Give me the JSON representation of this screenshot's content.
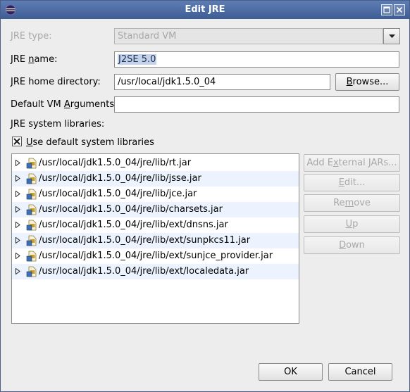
{
  "window": {
    "title": "Edit JRE"
  },
  "form": {
    "jre_type_label": "JRE type:",
    "jre_type_value": "Standard VM",
    "jre_name_label_pre": "JRE ",
    "jre_name_label_u": "n",
    "jre_name_label_post": "ame:",
    "jre_name_value": "J2SE 5.0",
    "home_label_u": "J",
    "home_label_post": "RE home directory:",
    "home_value": "/usr/local/jdk1.5.0_04",
    "browse_u": "B",
    "browse_post": "rowse...",
    "vm_args_label_pre": "Default VM ",
    "vm_args_label_u": "A",
    "vm_args_label_post": "rguments:",
    "vm_args_value": "",
    "system_libs_label": "JRE system libraries:",
    "use_default_u": "U",
    "use_default_post": "se default system libraries",
    "use_default_checked": true
  },
  "libraries": [
    "/usr/local/jdk1.5.0_04/jre/lib/rt.jar",
    "/usr/local/jdk1.5.0_04/jre/lib/jsse.jar",
    "/usr/local/jdk1.5.0_04/jre/lib/jce.jar",
    "/usr/local/jdk1.5.0_04/jre/lib/charsets.jar",
    "/usr/local/jdk1.5.0_04/jre/lib/ext/dnsns.jar",
    "/usr/local/jdk1.5.0_04/jre/lib/ext/sunpkcs11.jar",
    "/usr/local/jdk1.5.0_04/jre/lib/ext/sunjce_provider.jar",
    "/usr/local/jdk1.5.0_04/jre/lib/ext/localedata.jar"
  ],
  "side_buttons": {
    "add_external_jars": [
      "Add E",
      "x",
      "ternal JARs..."
    ],
    "edit": [
      "",
      "E",
      "dit..."
    ],
    "remove": [
      "Re",
      "m",
      "ove"
    ],
    "up": [
      "",
      "U",
      "p"
    ],
    "down": [
      "",
      "D",
      "own"
    ]
  },
  "footer": {
    "ok": "OK",
    "cancel": "Cancel"
  },
  "icons": {
    "app": "eclipse-icon",
    "maximize": "maximize-icon",
    "close": "close-icon",
    "dropdown": "chevron-down-icon",
    "expand": "expand-arrow-icon",
    "jar": "jar-icon"
  },
  "colors": {
    "titlebar": "#4a6aa5",
    "selection": "#c4d3ea",
    "row_alt": "#edf3fe"
  }
}
